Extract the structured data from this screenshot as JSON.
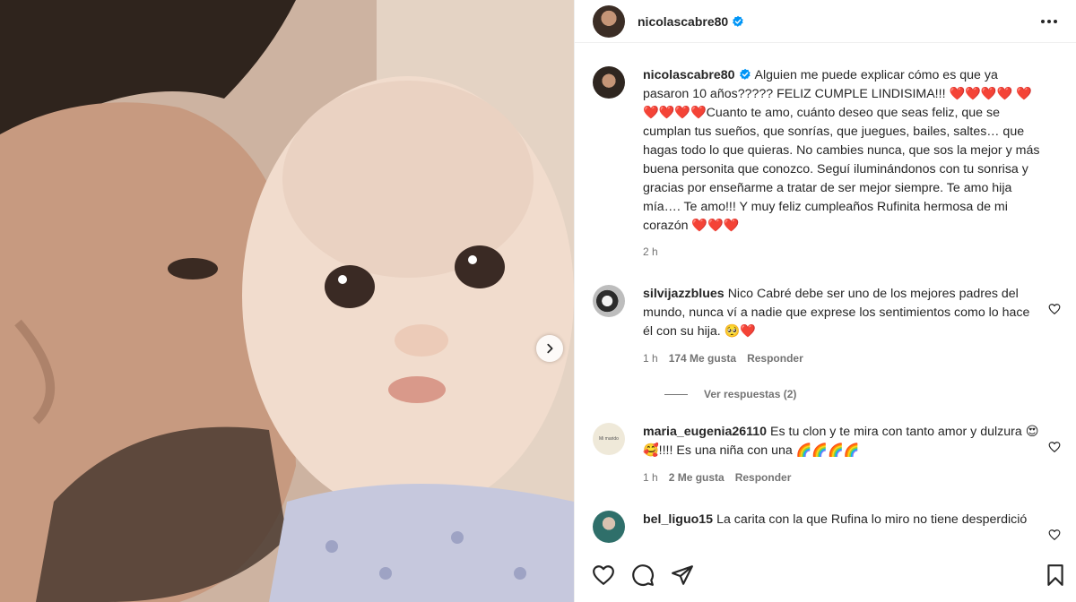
{
  "post": {
    "author": "nicolascabre80",
    "caption": "Alguien me puede explicar cómo es que ya pasaron 10 años????? FELIZ CUMPLE LINDISIMA!!! ❤️❤️❤️❤️ ❤️❤️❤️❤️❤️Cuanto te amo, cuánto deseo que seas feliz, que se cumplan tus sueños, que sonrías, que juegues, bailes, saltes… que hagas todo lo que quieras. No cambies nunca, que sos la mejor y más buena personita que conozco. Seguí iluminándonos con tu sonrisa y gracias por enseñarme a tratar de ser mejor siempre. Te amo hija mía…. Te amo!!! Y muy feliz cumpleaños Rufinita hermosa de mi corazón ❤️❤️❤️",
    "time": "2 h"
  },
  "comments": [
    {
      "user": "silvijazzblues",
      "text": "Nico Cabré debe ser uno de los mejores padres del mundo, nunca ví a nadie que exprese los sentimientos como lo hace él con su hija. 🥺❤️",
      "time": "1 h",
      "likes": "174 Me gusta",
      "reply": "Responder"
    },
    {
      "user": "maria_eugenia26110",
      "text": "Es tu clon y te mira con tanto amor y dulzura 😍🥰!!!! Es una niña con una 🌈🌈🌈🌈",
      "time": "1 h",
      "likes": "2 Me gusta",
      "reply": "Responder"
    },
    {
      "user": "bel_liguo15",
      "text": "La carita con la que Rufina lo miro no tiene desperdició"
    }
  ],
  "view_replies": "Ver respuestas (2)",
  "avatar_text": "Mi marido",
  "icons": [
    "verified-badge-icon",
    "more-options-icon",
    "heart-icon",
    "comment-icon",
    "share-icon",
    "bookmark-icon",
    "next-arrow-icon"
  ],
  "colors": {
    "verified": "#0095f6",
    "text": "#262626",
    "muted": "#737373"
  }
}
